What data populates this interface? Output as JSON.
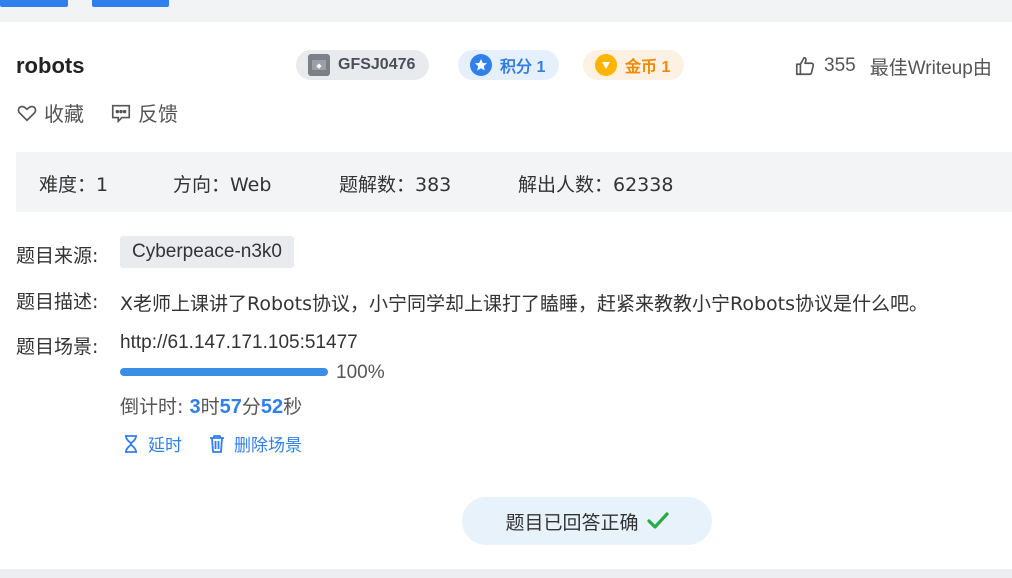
{
  "challenge": {
    "title": "robots",
    "id_badge": "GFSJ0476",
    "score_badge": "积分 1",
    "coin_badge": "金币 1",
    "likes": "355",
    "best_writeup": "最佳Writeup由"
  },
  "actions": {
    "favorite": "收藏",
    "feedback": "反馈"
  },
  "stats": {
    "difficulty": "难度：1",
    "direction": "方向：Web",
    "solves": "题解数：383",
    "solvers": "解出人数：62338"
  },
  "details": {
    "source_label": "题目来源:",
    "source_value": "Cyberpeace-n3k0",
    "desc_label": "题目描述:",
    "desc_value": "X老师上课讲了Robots协议，小宁同学却上课打了瞌睡，赶紧来教教小宁Robots协议是什么吧。",
    "scene_label": "题目场景:",
    "scene_url": "http://61.147.171.105:51477"
  },
  "progress": {
    "percent": 100,
    "text": "100%"
  },
  "countdown": {
    "prefix": "倒计时: ",
    "hours": "3",
    "hours_unit": "时",
    "minutes": "57",
    "minutes_unit": "分",
    "seconds": "52",
    "seconds_unit": "秒"
  },
  "ops": {
    "extend": "延时",
    "delete": "删除场景"
  },
  "status": {
    "answered": "题目已回答正确"
  },
  "colors": {
    "accent": "#2f80ed",
    "success": "#2aa84a",
    "coin": "#f08a00"
  }
}
